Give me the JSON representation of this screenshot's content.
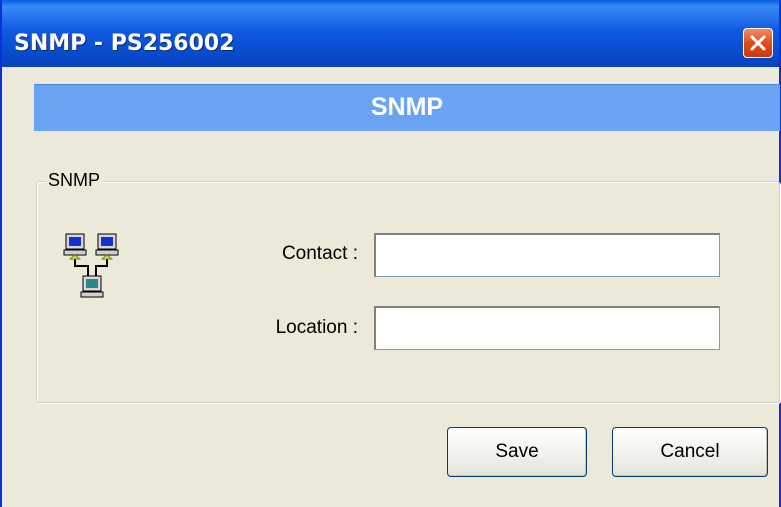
{
  "window": {
    "title": "SNMP - PS256002",
    "close_icon": "close-icon"
  },
  "header": {
    "title": "SNMP"
  },
  "group": {
    "legend": "SNMP",
    "icon": "network-computers-icon",
    "fields": [
      {
        "label": "Contact :",
        "value": "",
        "placeholder": ""
      },
      {
        "label": "Location :",
        "value": "",
        "placeholder": ""
      }
    ]
  },
  "buttons": {
    "save_label": "Save",
    "cancel_label": "Cancel"
  },
  "colors": {
    "titlebar": "#0a54d8",
    "header_band": "#6aa3f2",
    "dialog_background": "#ece9d8",
    "close_button": "#e24d1c"
  }
}
